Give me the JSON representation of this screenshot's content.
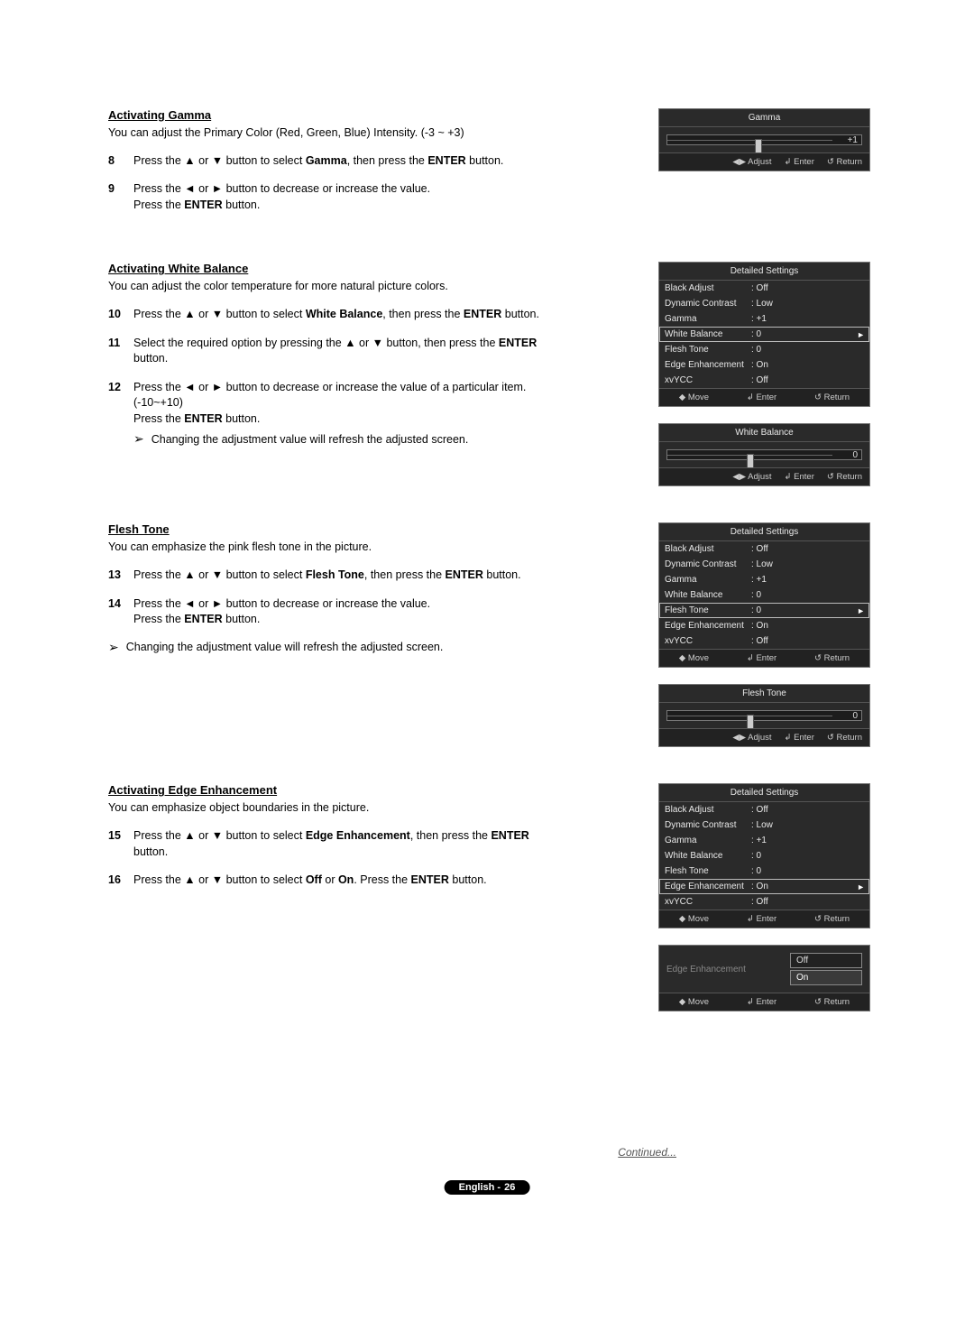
{
  "glyph": {
    "up": "▲",
    "down": "▼",
    "left": "◄",
    "right": "►",
    "note_arrow": "➢",
    "move": "◆",
    "enter": "↲",
    "return": "↺",
    "adjust": "◀▶"
  },
  "footer": {
    "language": "English -",
    "page": "26"
  },
  "continued_label": "Continued...",
  "sec_gamma": {
    "title": "Activating Gamma",
    "intro": "You can adjust the Primary Color (Red, Green, Blue) Intensity. (-3 ~ +3)",
    "s8_num": "8",
    "s8_a": "Press the ",
    "s8_b": " or ",
    "s8_c": " button to select ",
    "s8_term": "Gamma",
    "s8_d": ", then press the ",
    "s8_enter": "ENTER",
    "s8_e": " button.",
    "s9_num": "9",
    "s9_a": "Press the ",
    "s9_b": " or ",
    "s9_c": " button to decrease or increase the value.",
    "s9_d": "Press the ",
    "s9_enter": "ENTER",
    "s9_e": " button."
  },
  "sec_wb": {
    "title": "Activating White Balance",
    "intro": "You can adjust the color temperature for more natural picture colors.",
    "s10_num": "10",
    "s10_a": "Press the ",
    "s10_b": " or ",
    "s10_c": " button to select ",
    "s10_term": "White Balance",
    "s10_d": ", then press the ",
    "s10_enter": "ENTER",
    "s10_e": " button.",
    "s11_num": "11",
    "s11_a": "Select  the  required  option  by  pressing  the  ",
    "s11_b": "  or  ",
    "s11_c": "  button,  then  press  the ",
    "s11_enter": "ENTER",
    "s11_d": " button.",
    "s12_num": "12",
    "s12_a": "Press the ",
    "s12_b": " or ",
    "s12_c": " button to decrease or increase the value of a particular item. (-10~+10)",
    "s12_d": "Press the ",
    "s12_enter": "ENTER",
    "s12_e": " button.",
    "note": "Changing the adjustment value will refresh the adjusted screen."
  },
  "sec_ft": {
    "title": "Flesh Tone",
    "intro": "You can emphasize the pink flesh tone in the picture.",
    "s13_num": "13",
    "s13_a": "Press the ",
    "s13_b": " or ",
    "s13_c": " button to select ",
    "s13_term": "Flesh Tone",
    "s13_d": ", then press the ",
    "s13_enter": "ENTER",
    "s13_e": " button.",
    "s14_num": "14",
    "s14_a": "Press the ",
    "s14_b": " or ",
    "s14_c": " button to decrease or increase the value.",
    "s14_d": "Press the ",
    "s14_enter": "ENTER",
    "s14_e": " button.",
    "note": "Changing the adjustment value will refresh the adjusted screen."
  },
  "sec_ee": {
    "title": "Activating Edge Enhancement",
    "intro": "You can emphasize object boundaries in the picture.",
    "s15_num": "15",
    "s15_a": "Press the ",
    "s15_b": " or ",
    "s15_c": " button to select ",
    "s15_term": "Edge Enhancement",
    "s15_d": ", then press the ",
    "s15_enter": "ENTER",
    "s15_e": " button.",
    "s16_num": "16",
    "s16_a": "Press the ",
    "s16_b": " or ",
    "s16_c": " button to select ",
    "s16_off": "Off",
    "s16_or": " or ",
    "s16_on": "On",
    "s16_d": ". Press the ",
    "s16_enter": "ENTER",
    "s16_e": " button."
  },
  "osd": {
    "adjust": "Adjust",
    "enter": "Enter",
    "return": "Return",
    "move": "Move",
    "gamma_title": "Gamma",
    "gamma_val": "+1",
    "wb_title": "White Balance",
    "wb_val": "0",
    "ft_title": "Flesh Tone",
    "ft_val": "0",
    "ds_title": "Detailed Settings",
    "rows": {
      "black": {
        "label": "Black Adjust",
        "value": ": Off"
      },
      "dc": {
        "label": "Dynamic Contrast",
        "value": ": Low"
      },
      "gamma": {
        "label": "Gamma",
        "value": ": +1"
      },
      "wb": {
        "label": "White Balance",
        "value": ": 0"
      },
      "ft": {
        "label": "Flesh Tone",
        "value": ": 0"
      },
      "ee": {
        "label": "Edge Enhancement",
        "value": ": On"
      },
      "xv": {
        "label": "xvYCC",
        "value": ": Off"
      }
    },
    "ee_title": "Edge Enhancement",
    "ee_off": "Off",
    "ee_on": "On"
  }
}
